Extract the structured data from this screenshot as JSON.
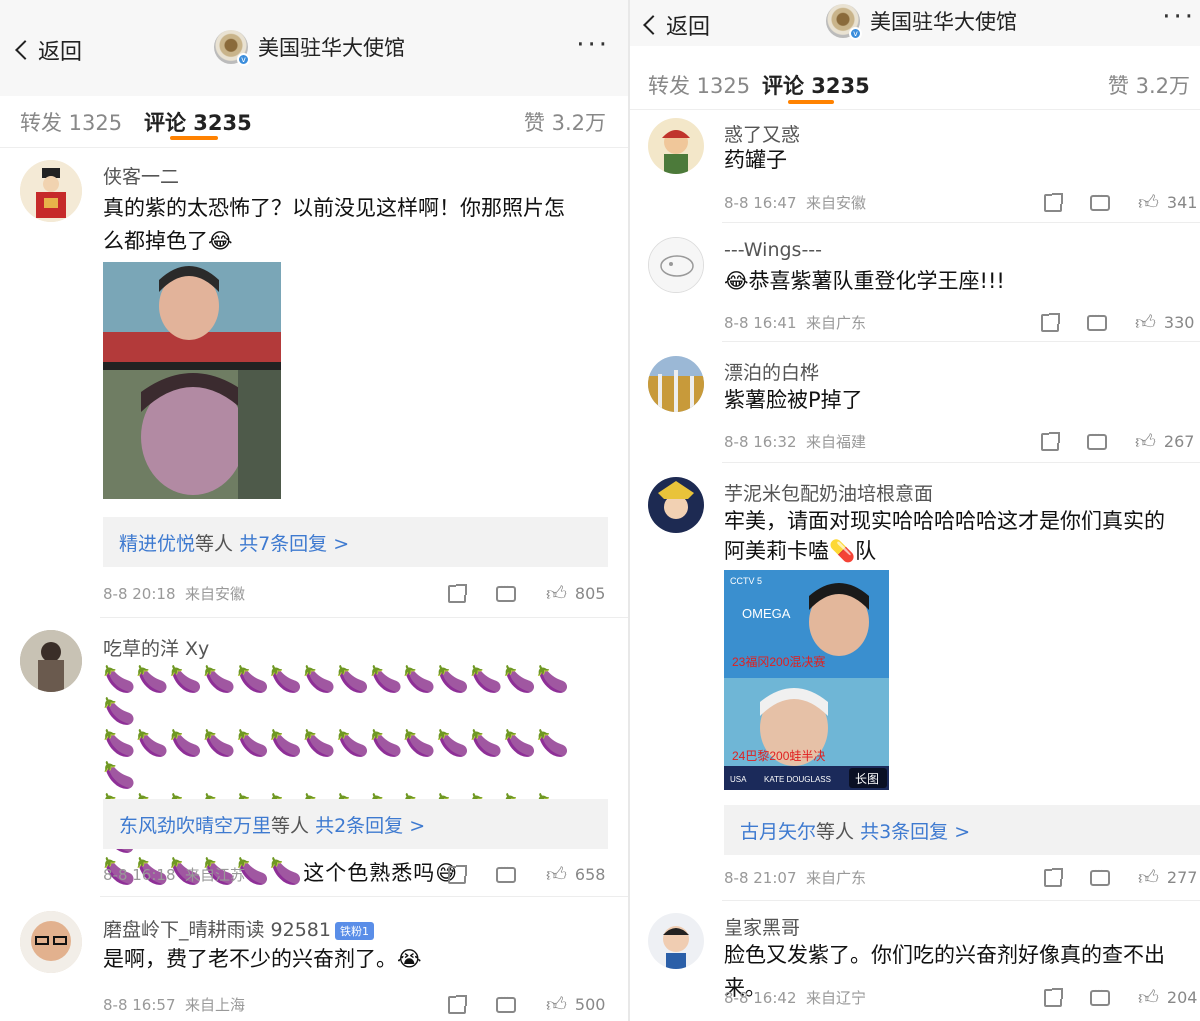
{
  "left": {
    "nav": {
      "back": "返回",
      "title": "美国驻华大使馆",
      "more": "···"
    },
    "tabs": {
      "repost": "转发 1325",
      "comments": "评论 3235",
      "likes": "赞 3.2万"
    },
    "comments": [
      {
        "name": "侠客一二",
        "text1": "真的紫的太恐怖了？以前没见这样啊！你那照片怎",
        "text2": "么都掉色了😂",
        "replies": {
          "who": "精进优悦",
          "mid": "等人",
          "count": "共7条回复 >"
        },
        "time": "8-8 20:18",
        "loc": "来自安徽",
        "likes": "805"
      },
      {
        "name": "吃草的洋 Xy",
        "eggplant_text": "这个色熟悉吗😅",
        "replies": {
          "who": "东风劲吹晴空万里",
          "mid": "等人",
          "count": "共2条回复 >"
        },
        "time": "8-8 16:18",
        "loc": "来自江苏",
        "likes": "658"
      },
      {
        "name": "磨盘岭下_晴耕雨读 92581",
        "badge": "铁粉1",
        "text1": "是啊，费了老不少的兴奋剂了。😭",
        "time": "8-8 16:57",
        "loc": "来自上海",
        "likes": "500"
      }
    ]
  },
  "right": {
    "nav": {
      "back": "返回",
      "title": "美国驻华大使馆",
      "more": "···"
    },
    "tabs": {
      "repost": "转发 1325",
      "comments": "评论 3235",
      "likes": "赞 3.2万"
    },
    "comments": [
      {
        "name": "惑了又惑",
        "text1": "药罐子",
        "time": "8-8 16:47",
        "loc": "来自安徽",
        "likes": "341"
      },
      {
        "name": "---Wings---",
        "text1": "😂恭喜紫薯队重登化学王座!!!",
        "time": "8-8 16:41",
        "loc": "来自广东",
        "likes": "330"
      },
      {
        "name": "漂泊的白桦",
        "text1": "紫薯脸被P掉了",
        "time": "8-8 16:32",
        "loc": "来自福建",
        "likes": "267"
      },
      {
        "name": "芋泥米包配奶油培根意面",
        "text1": "牢美，请面对现实哈哈哈哈哈这才是你们真实的",
        "text2": "阿美莉卡嗑💊队",
        "photo": {
          "top_caption": "23福冈200混决赛",
          "bottom_caption": "24巴黎200蛙半决",
          "omega": "OMEGA",
          "cctv": "CCTV 5",
          "long": "长图",
          "name_tag": "KATE DOUGLASS",
          "usa": "USA"
        },
        "replies": {
          "who": "古月矢尔",
          "mid": "等人",
          "count": "共3条回复 >"
        },
        "time": "8-8 21:07",
        "loc": "来自广东",
        "likes": "277"
      },
      {
        "name": "皇家黑哥",
        "text1": "脸色又发紫了。你们吃的兴奋剂好像真的查不出来。",
        "time": "8-8 16:42",
        "loc": "来自辽宁",
        "likes": "204"
      }
    ]
  }
}
